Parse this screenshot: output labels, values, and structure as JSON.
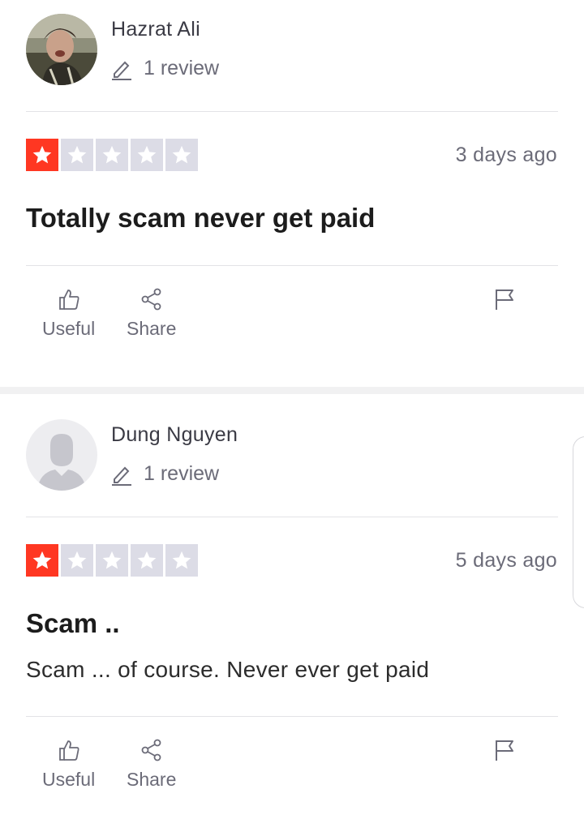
{
  "reviews": [
    {
      "reviewer_name": "Hazrat Ali",
      "review_count": "1 review",
      "rating": 1,
      "max_rating": 5,
      "date": "3 days ago",
      "title": "Totally scam never get paid",
      "body": "",
      "actions": {
        "useful": "Useful",
        "share": "Share"
      }
    },
    {
      "reviewer_name": "Dung Nguyen",
      "review_count": "1 review",
      "rating": 1,
      "max_rating": 5,
      "date": "5 days ago",
      "title": "Scam ..",
      "body": "Scam ... of course. Never ever get paid",
      "actions": {
        "useful": "Useful",
        "share": "Share"
      }
    }
  ],
  "colors": {
    "star_filled": "#ff3722",
    "star_empty": "#dcdce6",
    "tab_indicator": "#191934"
  },
  "icons": {
    "review_count": "pencil-icon",
    "useful": "thumbs-up-icon",
    "share": "share-icon",
    "report": "flag-icon",
    "star": "star-icon"
  }
}
